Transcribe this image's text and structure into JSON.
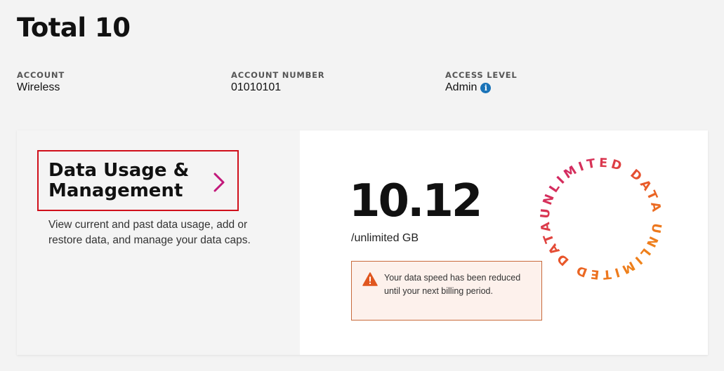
{
  "page": {
    "title": "Total 10"
  },
  "account": {
    "account_label": "ACCOUNT",
    "account_value": "Wireless",
    "number_label": "ACCOUNT NUMBER",
    "number_value": "01010101",
    "access_label": "ACCESS LEVEL",
    "access_value": "Admin",
    "info_glyph": "i"
  },
  "card": {
    "link_title": "Data Usage & Management",
    "description": "View current and past data usage, add or restore data, and manage your data caps.",
    "usage_value": "10.12",
    "usage_unit": "/unlimited GB",
    "alert_text": "Your data speed has been reduced until your next billing period.",
    "badge_text": "UNLIMITED DATA UNLIMITED DATA"
  },
  "colors": {
    "highlight_border": "#d0101b",
    "chevron": "#c2187a",
    "alert_border": "#c86a3b",
    "alert_bg": "#fdf1ec",
    "warn_icon": "#e0561f",
    "info_icon": "#1a73b8",
    "badge_gradient": [
      "#c8157e",
      "#e8542a",
      "#f29a12"
    ]
  },
  "icons": {
    "info": "info-icon",
    "chevron": "chevron-right-icon",
    "warning": "warning-triangle-icon"
  }
}
